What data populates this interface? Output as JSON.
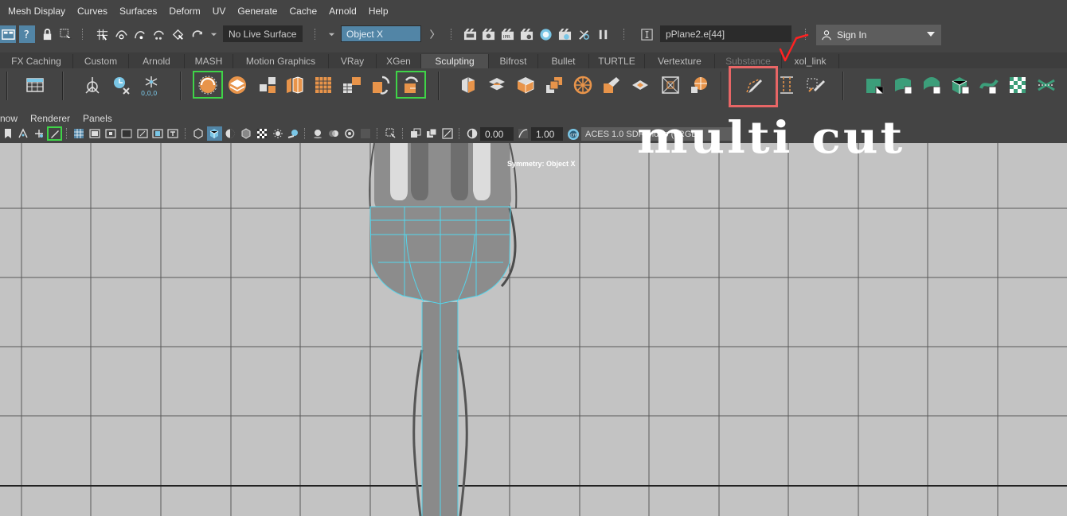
{
  "menubar": {
    "items": [
      "Mesh Display",
      "Curves",
      "Surfaces",
      "Deform",
      "UV",
      "Generate",
      "Cache",
      "Arnold",
      "Help"
    ]
  },
  "statusline": {
    "live_surface": "No Live Surface",
    "symmetry_mode": "Object X",
    "selection_field": "pPlane2.e[44]",
    "sign_in": "Sign In"
  },
  "shelf_tabs": {
    "items": [
      "FX Caching",
      "Custom",
      "Arnold",
      "MASH",
      "Motion Graphics",
      "VRay",
      "XGen",
      "Sculpting",
      "Bifrost",
      "Bullet",
      "TURTLE",
      "Vertexture",
      "Substance",
      "xol_link"
    ],
    "active": "Sculpting"
  },
  "shelf": {
    "highlighted_tool": "multi-cut-tool",
    "icons": [
      "locator-icon",
      "timer-cache-icon",
      "particle-emitter-icon",
      "soft-select-sphere-icon",
      "combine-icon",
      "separate-icon",
      "extract-icon",
      "smooth-mesh-icon",
      "mirror-icon",
      "boolean-icon",
      "remesh-icon",
      "retopo-icon",
      "bevel-icon",
      "bridge-icon",
      "extrude-icon",
      "wedge-icon",
      "poke-icon",
      "bevel-edge-icon",
      "append-icon",
      "chamfer-icon",
      "slide-edge-icon",
      "wireframe-icon",
      "fill-hole-icon",
      "multi-cut-icon",
      "edge-loop-icon",
      "target-weld-icon",
      "plane-uv-icon",
      "cylinder-uv-icon",
      "sphere-uv-icon",
      "auto-uv-icon",
      "uv-editor-icon",
      "checker-icon",
      "cut-uv-icon"
    ],
    "coord_label": "0,0,0"
  },
  "panel_menu": {
    "items": [
      "now",
      "Renderer",
      "Panels"
    ]
  },
  "panel_toolbar": {
    "exposure": "0.00",
    "gamma": "1.00",
    "color_transform": "ACES 1.0 SDR-video (sRGB)"
  },
  "viewport": {
    "symmetry_label": "Symmetry: Object X",
    "overlay_caption": "multi cut"
  },
  "colors": {
    "ui_dark": "#444444",
    "field_dark": "#2b2b2b",
    "symmetry_blue": "#5285a6",
    "accent_orange": "#e8944a",
    "highlight_red": "#e86666",
    "selection_green": "#3fd448",
    "viewport_bg": "#c3c3c3",
    "wire_cyan": "#54d6ec"
  }
}
